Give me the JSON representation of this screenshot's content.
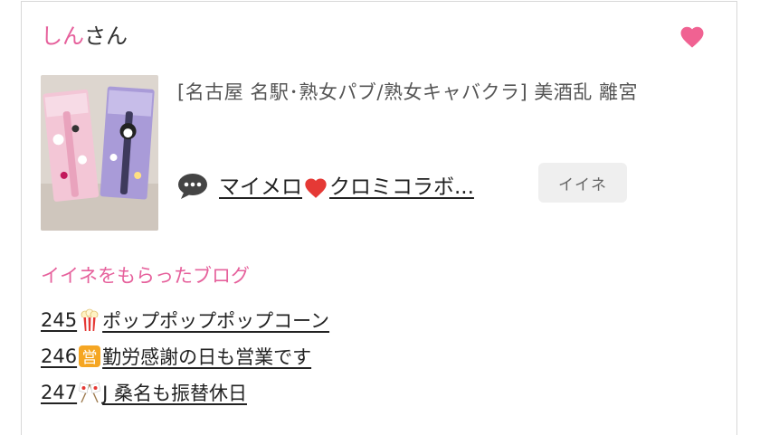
{
  "user": {
    "name": "しん",
    "suffix": "さん"
  },
  "favorite": {
    "icon": "heart-icon",
    "color": "#f06292"
  },
  "shop": {
    "name": "[名古屋 名駅･熟女パブ/熟女キャバクラ]  美酒乱 離宮"
  },
  "comment": {
    "icon": "speech-bubble-icon",
    "text_before": "マイメロ",
    "emoji": "red-heart-icon",
    "text_after": "クロミコラボ..."
  },
  "like_button": {
    "label": "イイネ"
  },
  "liked_blogs": {
    "title": "イイネをもらったブログ",
    "items": [
      {
        "number": "245",
        "icon": "popcorn-icon",
        "title": " ポップポップポップコーン "
      },
      {
        "number": "246",
        "icon": "business-badge-icon",
        "title": "勤労感謝の日も営業です"
      },
      {
        "number": "247",
        "icon": "crossed-flags-icon",
        "title": " J 桑名も振替休日"
      }
    ]
  },
  "colors": {
    "accent": "#e6619c",
    "button_bg": "#efefef"
  }
}
